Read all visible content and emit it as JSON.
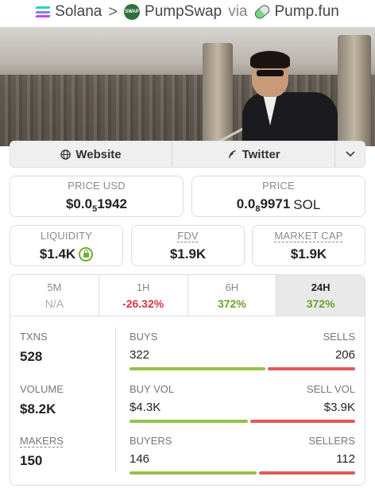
{
  "breadcrumb": {
    "chain": "Solana",
    "separator": ">",
    "dex": "PumpSwap",
    "via": "via",
    "launchpad": "Pump.fun"
  },
  "links": {
    "website": "Website",
    "twitter": "Twitter",
    "more_icon": "chevron-down-icon"
  },
  "price_usd": {
    "label": "PRICE USD",
    "prefix": "$0.0",
    "zeros": "5",
    "digits": "1942"
  },
  "price_native": {
    "label": "PRICE",
    "prefix": "0.0",
    "zeros": "8",
    "digits": "9971",
    "unit": "SOL"
  },
  "liquidity": {
    "label": "LIQUIDITY",
    "value": "$1.4K",
    "locked": true
  },
  "fdv": {
    "label": "FDV",
    "value": "$1.9K"
  },
  "market_cap": {
    "label": "MARKET CAP",
    "value": "$1.9K"
  },
  "tabs": [
    {
      "label": "5M",
      "value": "N/A",
      "tone": "na",
      "active": false
    },
    {
      "label": "1H",
      "value": "-26.32%",
      "tone": "neg",
      "active": false
    },
    {
      "label": "6H",
      "value": "372%",
      "tone": "pos",
      "active": false
    },
    {
      "label": "24H",
      "value": "372%",
      "tone": "pos",
      "active": true
    }
  ],
  "stats": {
    "txns": {
      "label": "TXNS",
      "value": "528"
    },
    "volume": {
      "label": "VOLUME",
      "value": "$8.2K"
    },
    "makers": {
      "label": "MAKERS",
      "value": "150"
    }
  },
  "splits": {
    "txns": {
      "left_label": "BUYS",
      "right_label": "SELLS",
      "left_value": "322",
      "right_value": "206",
      "left_share": 0.61
    },
    "volume": {
      "left_label": "BUY VOL",
      "right_label": "SELL VOL",
      "left_value": "$4.3K",
      "right_value": "$3.9K",
      "left_share": 0.53
    },
    "makers": {
      "left_label": "BUYERS",
      "right_label": "SELLERS",
      "left_value": "146",
      "right_value": "112",
      "left_share": 0.57
    }
  },
  "colors": {
    "positive": "#6aa22c",
    "negative": "#d9363e",
    "buy_bar": "#95c24c",
    "sell_bar": "#e05a5a"
  }
}
